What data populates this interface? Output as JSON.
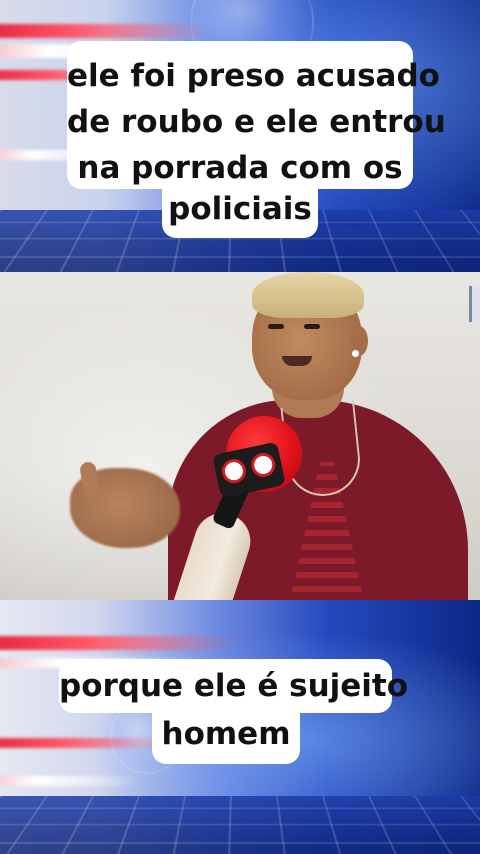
{
  "top_caption": {
    "lines": [
      "ele foi preso acusado",
      "de roubo e ele entrou",
      "na porrada com os",
      "policiais"
    ]
  },
  "bottom_caption": {
    "lines": [
      "porque ele é sujeito",
      "homem"
    ]
  },
  "colors": {
    "caption_bg": "#ffffff",
    "caption_text": "#111111",
    "band_blue": "#1d43b8",
    "band_red": "#e2233d",
    "mic_red": "#e0101a",
    "shirt": "#7d1a2a"
  },
  "video": {
    "mic_icon": "news-microphone-icon"
  }
}
